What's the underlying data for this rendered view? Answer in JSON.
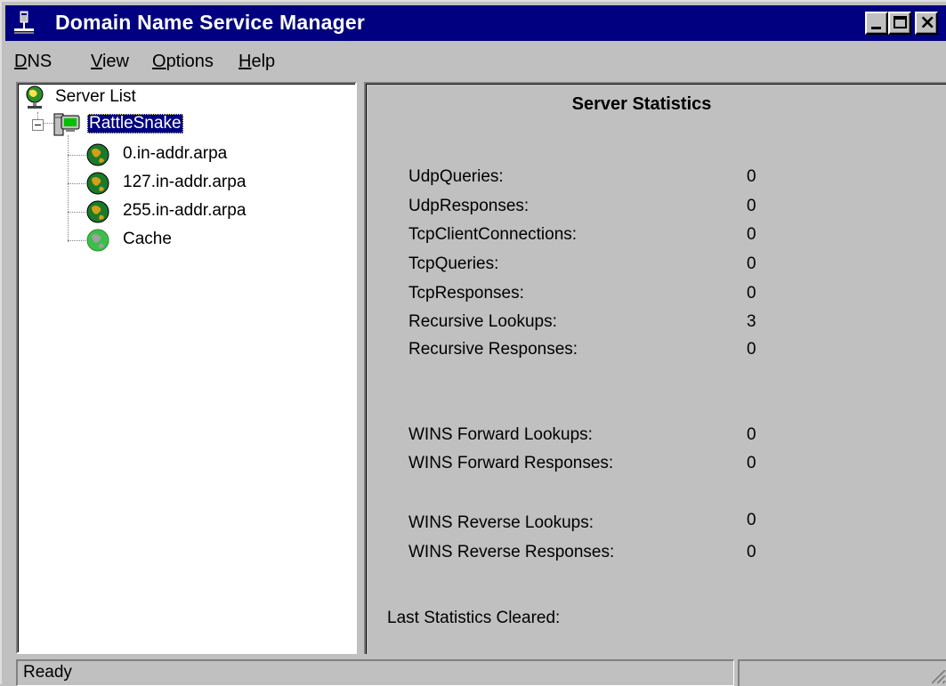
{
  "window": {
    "title": "Domain Name Service Manager",
    "title_bar_color": "#000080"
  },
  "menu": {
    "items": [
      {
        "accel": "D",
        "rest": "NS"
      },
      {
        "accel": "V",
        "rest": "iew"
      },
      {
        "accel": "O",
        "rest": "ptions"
      },
      {
        "accel": "H",
        "rest": "elp"
      }
    ]
  },
  "tree": {
    "root_label": "Server List",
    "server_label": "RattleSnake",
    "zones": [
      {
        "label": "0.in-addr.arpa",
        "icon": "globe-icon"
      },
      {
        "label": "127.in-addr.arpa",
        "icon": "globe-icon"
      },
      {
        "label": "255.in-addr.arpa",
        "icon": "globe-icon"
      },
      {
        "label": "Cache",
        "icon": "cache-globe-icon"
      }
    ]
  },
  "stats": {
    "title": "Server Statistics",
    "rows": [
      {
        "label": "UdpQueries:",
        "value": "0"
      },
      {
        "label": "UdpResponses:",
        "value": "0"
      },
      {
        "label": "TcpClientConnections:",
        "value": "0"
      },
      {
        "label": "TcpQueries:",
        "value": "0"
      },
      {
        "label": "TcpResponses:",
        "value": "0"
      },
      {
        "label": "Recursive Lookups:",
        "value": "3"
      },
      {
        "label": "Recursive Responses:",
        "value": "0"
      },
      {
        "label": "WINS Forward Lookups:",
        "value": "0"
      },
      {
        "label": "WINS Forward Responses:",
        "value": "0"
      },
      {
        "label": "WINS Reverse Lookups:",
        "value": "0"
      },
      {
        "label": "WINS Reverse Responses:",
        "value": "0"
      }
    ],
    "last_cleared_label": "Last Statistics Cleared:"
  },
  "status": {
    "text": "Ready"
  }
}
